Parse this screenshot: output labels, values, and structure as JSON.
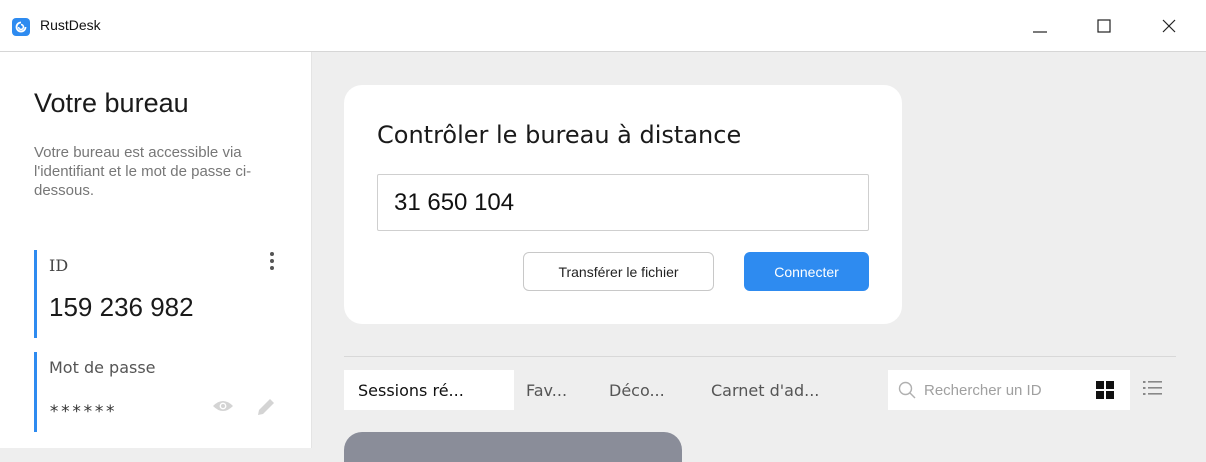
{
  "window": {
    "title": "RustDesk"
  },
  "left": {
    "title": "Votre bureau",
    "description": "Votre bureau est accessible via l'identifiant et le mot de passe ci-dessous.",
    "id_label": "ID",
    "id_value": "159 236 982",
    "password_label": "Mot de passe",
    "password_value": "******"
  },
  "connect": {
    "title": "Contrôler le bureau à distance",
    "remote_id_value": "31 650 104",
    "transfer_label": "Transférer le fichier",
    "connect_label": "Connecter"
  },
  "tabs": [
    {
      "label": "Sessions ré..."
    },
    {
      "label": "Fav..."
    },
    {
      "label": "Déco..."
    },
    {
      "label": "Carnet d'ad..."
    }
  ],
  "search": {
    "placeholder": "Rechercher un ID"
  },
  "colors": {
    "accent": "#2e8bf0",
    "background": "#eeeeee",
    "card": "#ffffff"
  },
  "icons": [
    "app-logo-icon",
    "minimize-icon",
    "maximize-icon",
    "close-icon",
    "kebab-menu-icon",
    "eye-icon",
    "pencil-icon",
    "search-icon",
    "grid-view-icon",
    "list-view-icon"
  ]
}
